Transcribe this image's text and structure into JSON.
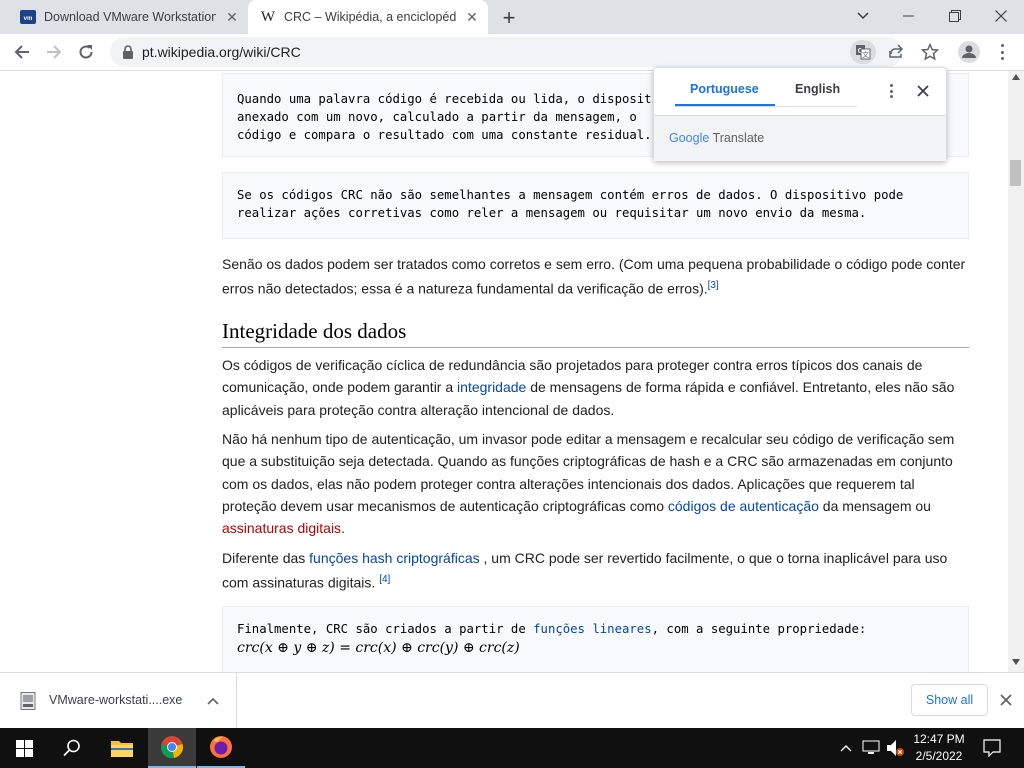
{
  "tabs": [
    {
      "title": "Download VMware Workstation P",
      "favicon": "vmware-icon"
    },
    {
      "title": "CRC – Wikipédia, a enciclopédia li",
      "favicon": "wikipedia-icon"
    }
  ],
  "toolbar": {
    "url": "pt.wikipedia.org/wiki/CRC"
  },
  "article": {
    "code1": [
      "Quando uma palavra código é recebida ou lida, o dispositivo o",
      "anexado com um novo, calculado a partir da mensagem, o",
      "código e compara o resultado com uma constante residual."
    ],
    "code2": [
      "Se os códigos CRC não são semelhantes a mensagem contém erros de dados. O dispositivo pode",
      "realizar ações corretivas como reler a mensagem ou requisitar um novo envio da mesma."
    ],
    "p1": "Senão os dados podem ser tratados como corretos e sem erro. (Com uma pequena probabilidade o código pode conter erros não detectados; essa é a natureza fundamental da verificação de erros).",
    "p1_ref": "[3]",
    "heading": "Integridade dos dados",
    "p2_a": "Os códigos de verificação cíclica de redundância são projetados para proteger contra erros típicos dos canais de comunicação, onde podem garantir a ",
    "p2_link": "integridade",
    "p2_b": " de mensagens de forma rápida e confiável. Entretanto, eles não são aplicáveis para proteção contra alteração intencional de dados.",
    "p3_a": "Não há nenhum tipo de autenticação, um invasor pode editar a mensagem e recalcular seu código de verificação sem que a substituição seja detectada. Quando as funções criptográficas de hash e a CRC são armazenadas em conjunto com os dados, elas não podem proteger contra alterações intencionais dos dados. Aplicações que requerem tal proteção devem usar mecanismos de autenticação criptográficas como ",
    "p3_link": "códigos de autenticação",
    "p3_b": " da mensagem ou ",
    "p3_redlink": "assinaturas digitais",
    "p3_c": ".",
    "p4_a": "Diferente das ",
    "p4_link": "funções hash criptográficas",
    "p4_b": " , um CRC pode ser revertido facilmente, o que o torna inaplicável para uso com assinaturas digitais. ",
    "p4_ref": "[4]",
    "code3_a": "Finalmente, CRC são criados a partir de ",
    "code3_link": "funções lineares",
    "code3_b": ", com a seguinte propriedade:",
    "formula": "crc(x ⊕ y ⊕ z) = crc(x) ⊕ crc(y) ⊕ crc(z)"
  },
  "translate": {
    "lang_source": "Portuguese",
    "lang_target": "English",
    "brand_google": "Google",
    "brand_translate": "Translate"
  },
  "downloads": {
    "filename": "VMware-workstati....exe",
    "show_all": "Show all"
  },
  "taskbar": {
    "time": "12:47 PM",
    "date": "2/5/2022"
  }
}
